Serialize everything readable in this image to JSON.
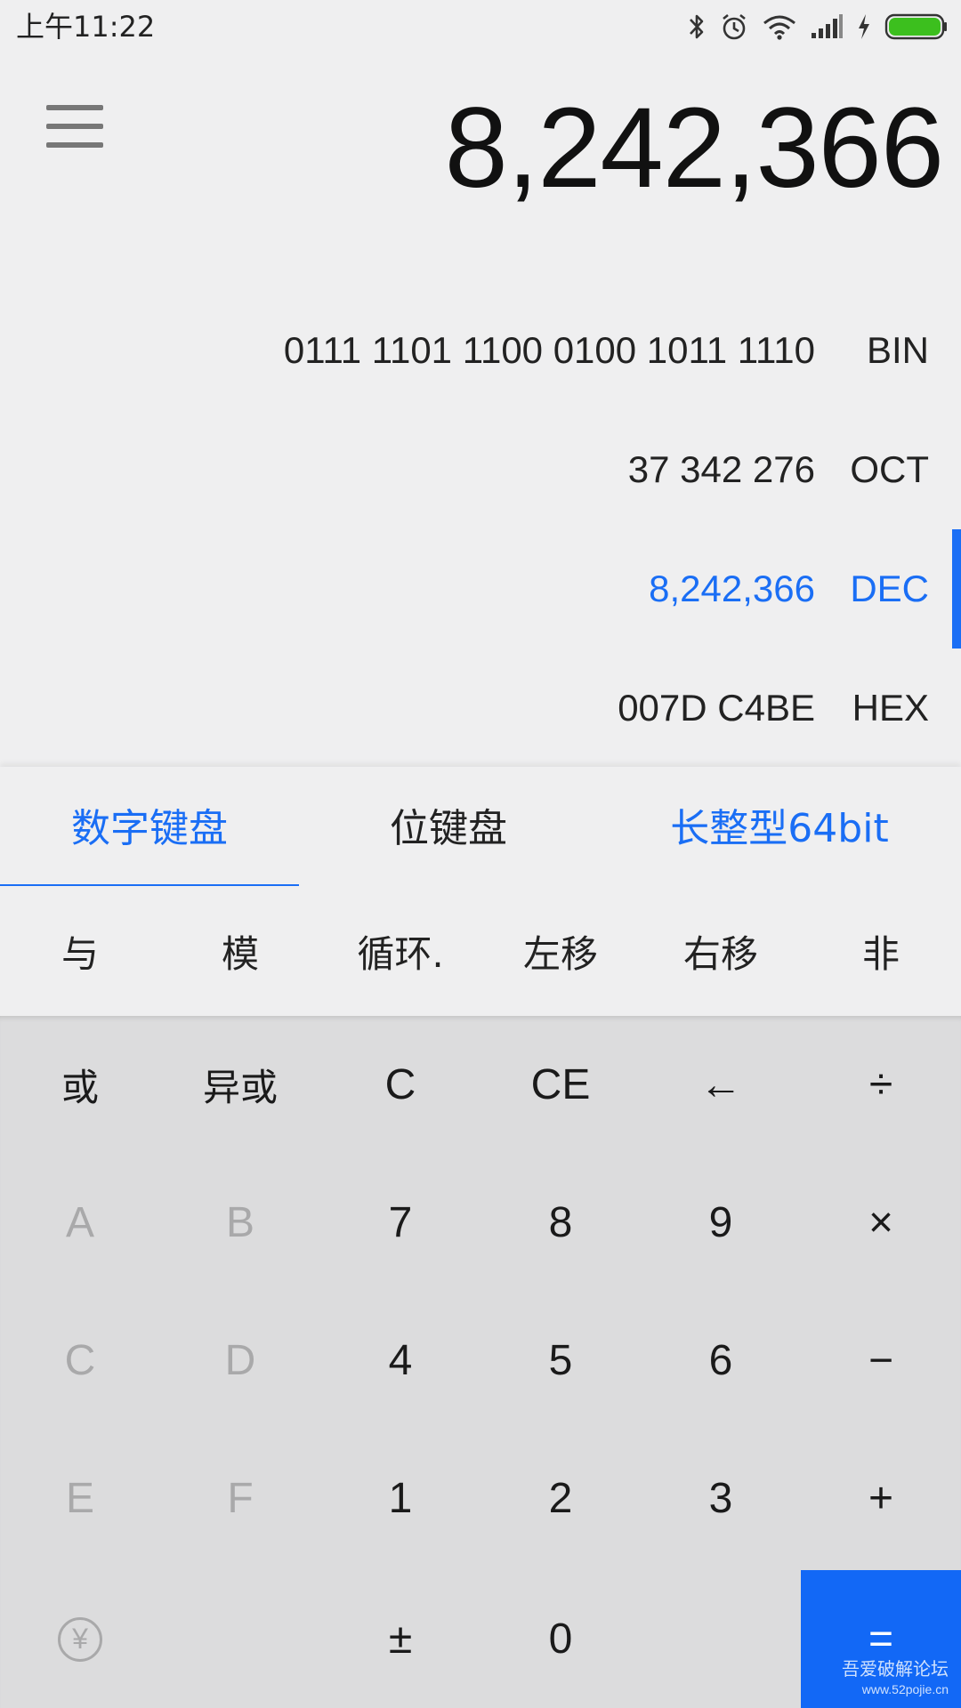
{
  "status_bar": {
    "time": "上午11:22",
    "icons": [
      "bluetooth-icon",
      "alarm-icon",
      "wifi-icon",
      "signal-icon",
      "charging-icon",
      "battery-icon"
    ],
    "battery_color": "#3cbf1e"
  },
  "display": {
    "menu_icon": "hamburger-menu-icon",
    "main_value": "8,242,366"
  },
  "bases": [
    {
      "value": "0111 1101 1100 0100 1011 1110",
      "label": "BIN",
      "active": false
    },
    {
      "value": "37 342 276",
      "label": "OCT",
      "active": false
    },
    {
      "value": "8,242,366",
      "label": "DEC",
      "active": true
    },
    {
      "value": "007D C4BE",
      "label": "HEX",
      "active": false
    }
  ],
  "tabs": {
    "numeric": "数字键盘",
    "bit": "位键盘",
    "type": "长整型64bit"
  },
  "operators": [
    "与",
    "模",
    "循环.",
    "左移",
    "右移",
    "非"
  ],
  "keys": {
    "row1": [
      "或",
      "异或",
      "C",
      "CE",
      "←",
      "÷"
    ],
    "row2": [
      "A",
      "B",
      "7",
      "8",
      "9",
      "×"
    ],
    "row3": [
      "C",
      "D",
      "4",
      "5",
      "6",
      "−"
    ],
    "row4": [
      "E",
      "F",
      "1",
      "2",
      "3",
      "+"
    ],
    "row5": {
      "currency": "¥",
      "plus_minus": "±",
      "zero": "0",
      "equals": "="
    }
  },
  "watermark": {
    "line1": "吾爱破解论坛",
    "line2": "www.52pojie.cn"
  },
  "colors": {
    "accent": "#1a6ef5",
    "background": "#efeff0",
    "keypad": "#dcdcdd",
    "disabled_text": "#a9a9aa"
  }
}
